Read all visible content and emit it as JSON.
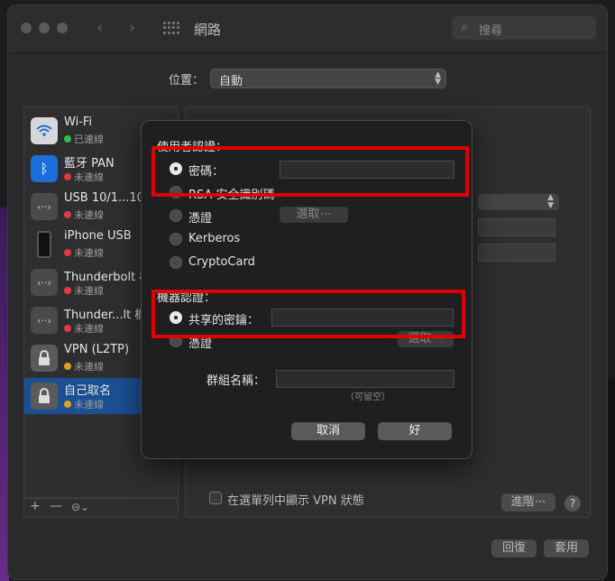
{
  "window": {
    "title": "網路",
    "search_placeholder": "搜尋",
    "location_label": "位置：",
    "location_value": "自動"
  },
  "services": [
    {
      "name": "Wi-Fi",
      "status": "已連線",
      "status_color": "#30c04a",
      "icon": "wifi-icon"
    },
    {
      "name": "藍牙 PAN",
      "status": "未連線",
      "status_color": "#e03c3c",
      "icon": "bluetooth-icon"
    },
    {
      "name": "USB 10/1...1000",
      "status": "未連線",
      "status_color": "#e03c3c",
      "icon": "ethernet-icon"
    },
    {
      "name": "iPhone USB",
      "status": "未連線",
      "status_color": "#e03c3c",
      "icon": "iphone-icon"
    },
    {
      "name": "Thunderbolt 橋",
      "status": "未連線",
      "status_color": "#e03c3c",
      "icon": "ethernet-icon"
    },
    {
      "name": "Thunder...lt 橋接",
      "status": "未連線",
      "status_color": "#e03c3c",
      "icon": "ethernet-icon"
    },
    {
      "name": "VPN (L2TP)",
      "status": "未連線",
      "status_color": "#e0a020",
      "icon": "lock-icon"
    },
    {
      "name": "自己取名",
      "status": "未連線",
      "status_color": "#e0a020",
      "icon": "lock-icon",
      "selected": true
    }
  ],
  "sidebar_toolbar": {
    "add": "+",
    "remove": "—",
    "action": "⊝⌄"
  },
  "main": {
    "show_vpn_status_label": "在選單列中顯示 VPN 狀態",
    "advanced_button": "進階⋯",
    "help_button": "?",
    "revert_button": "回復",
    "apply_button": "套用"
  },
  "dialog": {
    "user_auth_title": "使用者認證：",
    "user_auth_options": [
      "密碼：",
      "RSA 安全識別碼",
      "憑證",
      "Kerberos",
      "CryptoCard"
    ],
    "user_auth_selected": 0,
    "select_button": "選取⋯",
    "machine_auth_title": "機器認證：",
    "machine_auth_options": [
      "共享的密鑰：",
      "憑證"
    ],
    "machine_auth_selected": 0,
    "machine_select_button": "選取⋯",
    "group_name_label": "群組名稱：",
    "group_name_hint": "（可留空）",
    "cancel_button": "取消",
    "ok_button": "好"
  },
  "highlight_color": "#e00000"
}
